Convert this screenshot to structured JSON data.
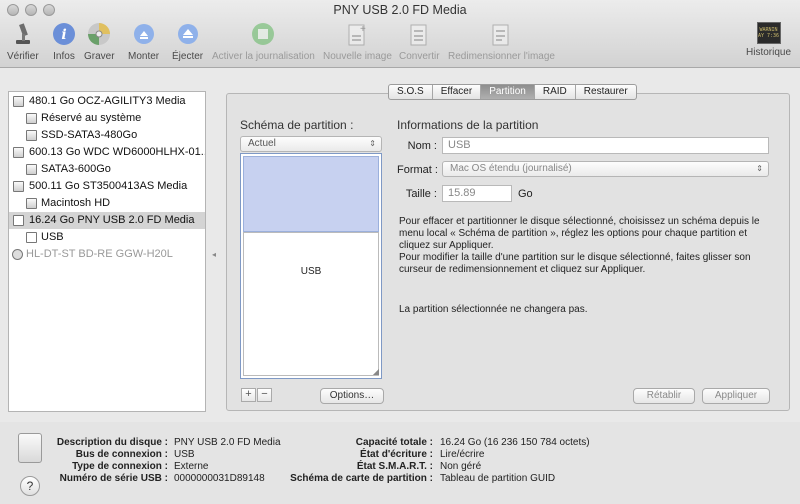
{
  "window": {
    "title": "PNY USB 2.0 FD Media"
  },
  "toolbar": {
    "verify": "Vérifier",
    "info": "Infos",
    "burn": "Graver",
    "mount": "Monter",
    "eject": "Éjecter",
    "journal": "Activer la journalisation",
    "new_image": "Nouvelle image",
    "convert": "Convertir",
    "resize_image": "Redimensionner l'image",
    "history": "Historique",
    "log_icon_text": "WARNIN\nAY 7:36"
  },
  "sidebar": {
    "items": [
      {
        "label": "480.1 Go OCZ-AGILITY3 Media"
      },
      {
        "label": "Réservé au système"
      },
      {
        "label": "SSD-SATA3-480Go"
      },
      {
        "label": "600.13 Go WDC WD6000HLHX-01..."
      },
      {
        "label": "SATA3-600Go"
      },
      {
        "label": "500.11 Go ST3500413AS Media"
      },
      {
        "label": "Macintosh HD"
      },
      {
        "label": "16.24 Go PNY USB 2.0 FD Media"
      },
      {
        "label": "USB"
      },
      {
        "label": "HL-DT-ST BD-RE GGW-H20L"
      }
    ]
  },
  "tabs": [
    "S.O.S",
    "Effacer",
    "Partition",
    "RAID",
    "Restaurer"
  ],
  "partition": {
    "scheme_title": "Schéma de partition :",
    "scheme_value": "Actuel",
    "partition_label": "USB",
    "info_title": "Informations de la partition",
    "name_label": "Nom :",
    "name_value": "USB",
    "format_label": "Format :",
    "format_value": "Mac OS étendu (journalisé)",
    "size_label": "Taille :",
    "size_value": "15.89",
    "size_unit": "Go",
    "help_line1": "Pour effacer et partitionner le disque sélectionné, choisissez un schéma depuis le",
    "help_line2": "menu local « Schéma de partition », réglez les options pour chaque partition et",
    "help_line3": "cliquez sur Appliquer.",
    "help_line4": "Pour modifier la taille d'une partition sur le disque sélectionné, faites glisser son",
    "help_line5": "curseur de redimensionnement et cliquez sur Appliquer.",
    "no_change": "La partition sélectionnée ne changera pas.",
    "plus": "+",
    "minus": "−",
    "options": "Options…",
    "revert": "Rétablir",
    "apply": "Appliquer"
  },
  "details": {
    "desc_label": "Description du disque :",
    "desc_value": "PNY USB 2.0 FD Media",
    "bus_label": "Bus de connexion :",
    "bus_value": "USB",
    "conn_label": "Type de connexion :",
    "conn_value": "Externe",
    "serial_label": "Numéro de série USB :",
    "serial_value": "0000000031D89148",
    "cap_label": "Capacité totale :",
    "cap_value": "16.24 Go (16 236 150 784 octets)",
    "write_label": "État d'écriture :",
    "write_value": "Lire/écrire",
    "smart_label": "État S.M.A.R.T. :",
    "smart_value": "Non géré",
    "map_label": "Schéma de carte de partition :",
    "map_value": "Tableau de partition GUID",
    "help": "?"
  }
}
